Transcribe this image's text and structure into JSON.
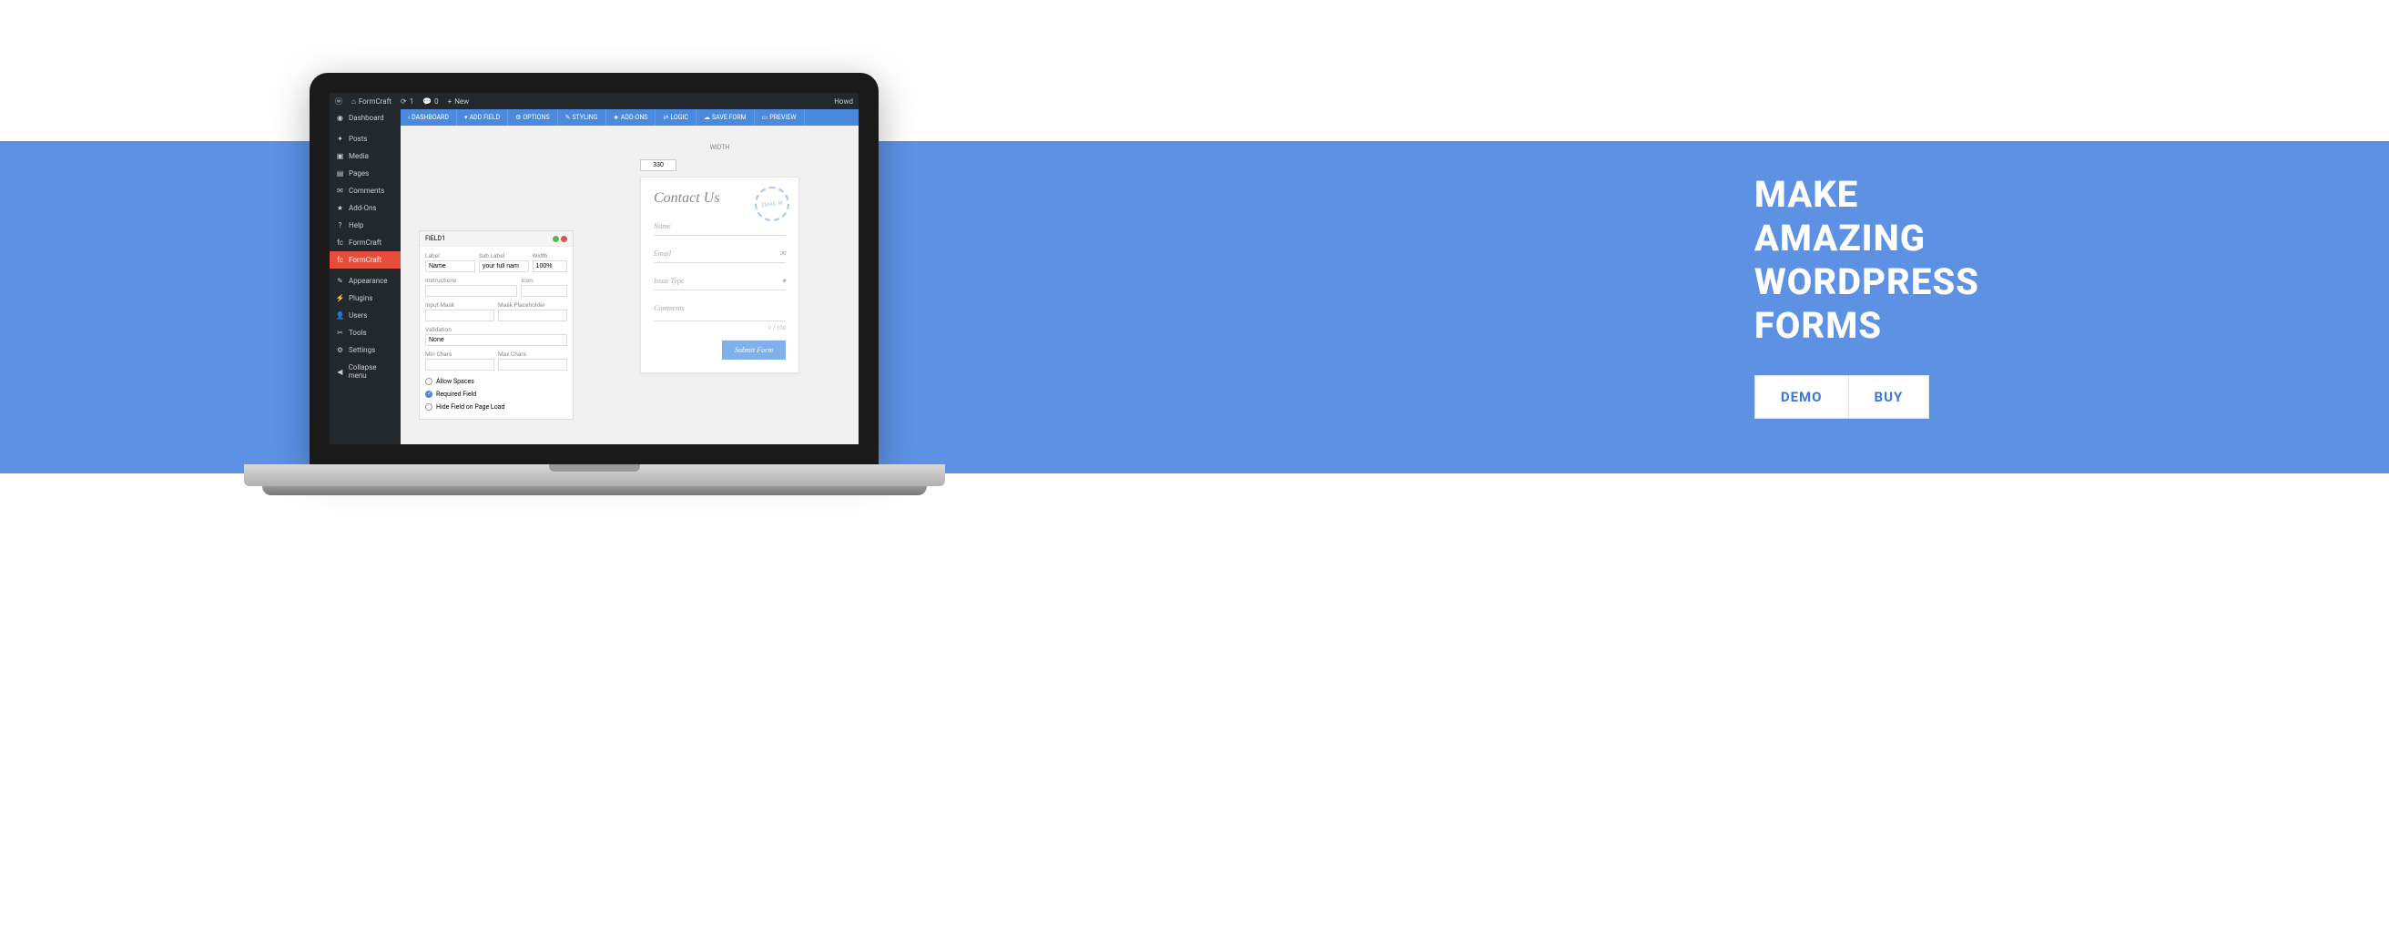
{
  "hero": {
    "line1": "MAKE",
    "line2": "AMAZING",
    "line3": "WORDPRESS",
    "line4": "FORMS",
    "demo_btn": "DEMO",
    "buy_btn": "BUY"
  },
  "wp_bar": {
    "site": "FormCraft",
    "updates": "1",
    "comments": "0",
    "new": "New",
    "user": "Howd"
  },
  "sidebar": {
    "items": [
      {
        "label": "Dashboard",
        "icon": "⚙"
      },
      {
        "label": "Posts",
        "icon": "📌"
      },
      {
        "label": "Media",
        "icon": "🖼"
      },
      {
        "label": "Pages",
        "icon": "📄"
      },
      {
        "label": "Comments",
        "icon": "💬"
      },
      {
        "label": "Add-Ons",
        "icon": "★"
      },
      {
        "label": "Help",
        "icon": "?"
      },
      {
        "label": "FormCraft",
        "icon": "fc"
      },
      {
        "label": "FormCraft",
        "icon": "fc",
        "active": true
      },
      {
        "label": "Appearance",
        "icon": "🖌"
      },
      {
        "label": "Plugins",
        "icon": "🔌"
      },
      {
        "label": "Users",
        "icon": "👤"
      },
      {
        "label": "Tools",
        "icon": "🔧"
      },
      {
        "label": "Settings",
        "icon": "⚙"
      },
      {
        "label": "Collapse menu",
        "icon": "◀"
      }
    ]
  },
  "toolbar": {
    "items": [
      {
        "label": "DASHBOARD"
      },
      {
        "label": "ADD FIELD"
      },
      {
        "label": "OPTIONS"
      },
      {
        "label": "STYLING"
      },
      {
        "label": "ADD-ONS"
      },
      {
        "label": "LOGIC"
      },
      {
        "label": "SAVE FORM"
      },
      {
        "label": "PREVIEW"
      }
    ]
  },
  "field_panel": {
    "title": "FIELD1",
    "label_lbl": "Label",
    "label_val": "Name",
    "sublabel_lbl": "Sub Label",
    "sublabel_val": "your full nam",
    "width_lbl": "Width",
    "width_val": "100%",
    "instr_lbl": "Instructions",
    "instr_val": "",
    "icon_lbl": "Icon:",
    "icon_val": "",
    "mask_lbl": "Input Mask",
    "mask_val": "",
    "maskph_lbl": "Mask Placeholder",
    "maskph_val": "",
    "valid_lbl": "Validation",
    "valid_val": "None",
    "min_lbl": "Min Chars",
    "min_val": "",
    "max_lbl": "Max Chars",
    "max_val": "",
    "allow_spaces": "Allow Spaces",
    "required": "Required Field",
    "hide_load": "Hide Field on Page Load"
  },
  "form": {
    "width_lbl": "WIDTH",
    "width_val": "330",
    "title": "Contact Us",
    "stamp": "EMAIL M",
    "name_ph": "Name",
    "email_ph": "Email",
    "issue_ph": "Issue Type",
    "comments_ph": "Comments",
    "char_count": "0 / 100",
    "submit": "Submit Form"
  }
}
